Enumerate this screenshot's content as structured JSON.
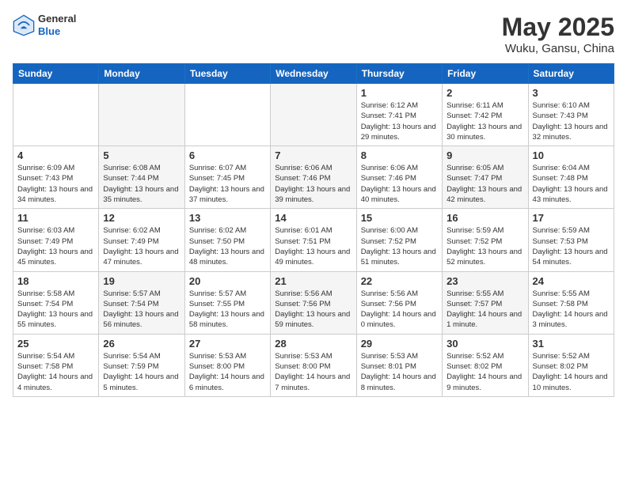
{
  "header": {
    "logo_general": "General",
    "logo_blue": "Blue",
    "title": "May 2025",
    "subtitle": "Wuku, Gansu, China"
  },
  "weekdays": [
    "Sunday",
    "Monday",
    "Tuesday",
    "Wednesday",
    "Thursday",
    "Friday",
    "Saturday"
  ],
  "weeks": [
    [
      {
        "day": "",
        "info": "",
        "empty": true
      },
      {
        "day": "",
        "info": "",
        "empty": true
      },
      {
        "day": "",
        "info": "",
        "empty": true
      },
      {
        "day": "",
        "info": "",
        "empty": true
      },
      {
        "day": "1",
        "info": "Sunrise: 6:12 AM\nSunset: 7:41 PM\nDaylight: 13 hours\nand 29 minutes.",
        "empty": false
      },
      {
        "day": "2",
        "info": "Sunrise: 6:11 AM\nSunset: 7:42 PM\nDaylight: 13 hours\nand 30 minutes.",
        "empty": false
      },
      {
        "day": "3",
        "info": "Sunrise: 6:10 AM\nSunset: 7:43 PM\nDaylight: 13 hours\nand 32 minutes.",
        "empty": false
      }
    ],
    [
      {
        "day": "4",
        "info": "Sunrise: 6:09 AM\nSunset: 7:43 PM\nDaylight: 13 hours\nand 34 minutes.",
        "empty": false
      },
      {
        "day": "5",
        "info": "Sunrise: 6:08 AM\nSunset: 7:44 PM\nDaylight: 13 hours\nand 35 minutes.",
        "empty": false
      },
      {
        "day": "6",
        "info": "Sunrise: 6:07 AM\nSunset: 7:45 PM\nDaylight: 13 hours\nand 37 minutes.",
        "empty": false
      },
      {
        "day": "7",
        "info": "Sunrise: 6:06 AM\nSunset: 7:46 PM\nDaylight: 13 hours\nand 39 minutes.",
        "empty": false
      },
      {
        "day": "8",
        "info": "Sunrise: 6:06 AM\nSunset: 7:46 PM\nDaylight: 13 hours\nand 40 minutes.",
        "empty": false
      },
      {
        "day": "9",
        "info": "Sunrise: 6:05 AM\nSunset: 7:47 PM\nDaylight: 13 hours\nand 42 minutes.",
        "empty": false
      },
      {
        "day": "10",
        "info": "Sunrise: 6:04 AM\nSunset: 7:48 PM\nDaylight: 13 hours\nand 43 minutes.",
        "empty": false
      }
    ],
    [
      {
        "day": "11",
        "info": "Sunrise: 6:03 AM\nSunset: 7:49 PM\nDaylight: 13 hours\nand 45 minutes.",
        "empty": false
      },
      {
        "day": "12",
        "info": "Sunrise: 6:02 AM\nSunset: 7:49 PM\nDaylight: 13 hours\nand 47 minutes.",
        "empty": false
      },
      {
        "day": "13",
        "info": "Sunrise: 6:02 AM\nSunset: 7:50 PM\nDaylight: 13 hours\nand 48 minutes.",
        "empty": false
      },
      {
        "day": "14",
        "info": "Sunrise: 6:01 AM\nSunset: 7:51 PM\nDaylight: 13 hours\nand 49 minutes.",
        "empty": false
      },
      {
        "day": "15",
        "info": "Sunrise: 6:00 AM\nSunset: 7:52 PM\nDaylight: 13 hours\nand 51 minutes.",
        "empty": false
      },
      {
        "day": "16",
        "info": "Sunrise: 5:59 AM\nSunset: 7:52 PM\nDaylight: 13 hours\nand 52 minutes.",
        "empty": false
      },
      {
        "day": "17",
        "info": "Sunrise: 5:59 AM\nSunset: 7:53 PM\nDaylight: 13 hours\nand 54 minutes.",
        "empty": false
      }
    ],
    [
      {
        "day": "18",
        "info": "Sunrise: 5:58 AM\nSunset: 7:54 PM\nDaylight: 13 hours\nand 55 minutes.",
        "empty": false
      },
      {
        "day": "19",
        "info": "Sunrise: 5:57 AM\nSunset: 7:54 PM\nDaylight: 13 hours\nand 56 minutes.",
        "empty": false
      },
      {
        "day": "20",
        "info": "Sunrise: 5:57 AM\nSunset: 7:55 PM\nDaylight: 13 hours\nand 58 minutes.",
        "empty": false
      },
      {
        "day": "21",
        "info": "Sunrise: 5:56 AM\nSunset: 7:56 PM\nDaylight: 13 hours\nand 59 minutes.",
        "empty": false
      },
      {
        "day": "22",
        "info": "Sunrise: 5:56 AM\nSunset: 7:56 PM\nDaylight: 14 hours\nand 0 minutes.",
        "empty": false
      },
      {
        "day": "23",
        "info": "Sunrise: 5:55 AM\nSunset: 7:57 PM\nDaylight: 14 hours\nand 1 minute.",
        "empty": false
      },
      {
        "day": "24",
        "info": "Sunrise: 5:55 AM\nSunset: 7:58 PM\nDaylight: 14 hours\nand 3 minutes.",
        "empty": false
      }
    ],
    [
      {
        "day": "25",
        "info": "Sunrise: 5:54 AM\nSunset: 7:58 PM\nDaylight: 14 hours\nand 4 minutes.",
        "empty": false
      },
      {
        "day": "26",
        "info": "Sunrise: 5:54 AM\nSunset: 7:59 PM\nDaylight: 14 hours\nand 5 minutes.",
        "empty": false
      },
      {
        "day": "27",
        "info": "Sunrise: 5:53 AM\nSunset: 8:00 PM\nDaylight: 14 hours\nand 6 minutes.",
        "empty": false
      },
      {
        "day": "28",
        "info": "Sunrise: 5:53 AM\nSunset: 8:00 PM\nDaylight: 14 hours\nand 7 minutes.",
        "empty": false
      },
      {
        "day": "29",
        "info": "Sunrise: 5:53 AM\nSunset: 8:01 PM\nDaylight: 14 hours\nand 8 minutes.",
        "empty": false
      },
      {
        "day": "30",
        "info": "Sunrise: 5:52 AM\nSunset: 8:02 PM\nDaylight: 14 hours\nand 9 minutes.",
        "empty": false
      },
      {
        "day": "31",
        "info": "Sunrise: 5:52 AM\nSunset: 8:02 PM\nDaylight: 14 hours\nand 10 minutes.",
        "empty": false
      }
    ]
  ]
}
